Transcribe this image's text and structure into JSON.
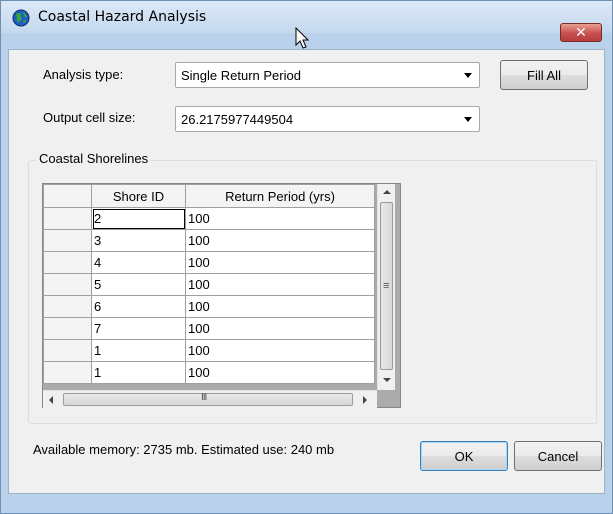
{
  "window": {
    "title": "Coastal Hazard Analysis",
    "close_label": "✕"
  },
  "form": {
    "analysis_type_label": "Analysis type:",
    "analysis_type_value": "Single Return Period",
    "fill_all_label": "Fill All",
    "cell_size_label": "Output cell size:",
    "cell_size_value": "26.2175977449504"
  },
  "shorelines": {
    "group_title": "Coastal Shorelines",
    "columns": [
      "Shore ID",
      "Return Period (yrs)"
    ],
    "rows": [
      {
        "id": "2",
        "rp": "100"
      },
      {
        "id": "3",
        "rp": "100"
      },
      {
        "id": "4",
        "rp": "100"
      },
      {
        "id": "5",
        "rp": "100"
      },
      {
        "id": "6",
        "rp": "100"
      },
      {
        "id": "7",
        "rp": "100"
      },
      {
        "id": "1",
        "rp": "100"
      },
      {
        "id": "1",
        "rp": "100"
      }
    ],
    "hscroll_grip": "III",
    "vscroll_grip": "≡"
  },
  "footer": {
    "status": "Available memory: 2735 mb. Estimated use: 240 mb",
    "ok_label": "OK",
    "cancel_label": "Cancel"
  },
  "colors": {
    "frame": "#b9d1ea",
    "client": "#f0f0f0",
    "close_red": "#c75050"
  }
}
